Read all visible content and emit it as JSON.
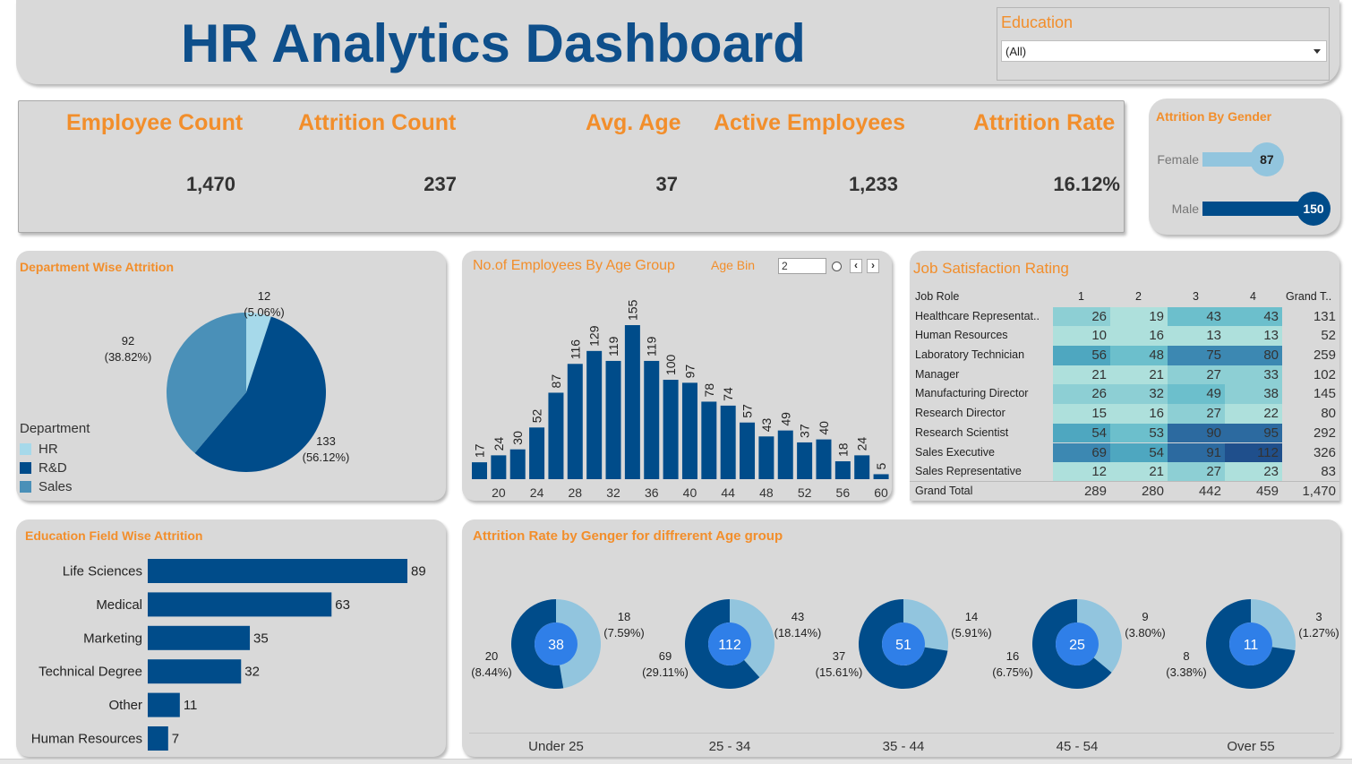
{
  "header": {
    "title": "HR Analytics Dashboard"
  },
  "filter": {
    "label": "Education",
    "value": "(All)"
  },
  "kpis": [
    {
      "title": "Employee Count",
      "value": "1,470"
    },
    {
      "title": "Attrition Count",
      "value": "237"
    },
    {
      "title": "Avg. Age",
      "value": "37"
    },
    {
      "title": "Active Employees",
      "value": "1,233"
    },
    {
      "title": "Attrition Rate",
      "value": "16.12%"
    }
  ],
  "gender": {
    "title": "Attrition By Gender",
    "rows": [
      {
        "label": "Female",
        "value": 87,
        "value_text": "87"
      },
      {
        "label": "Male",
        "value": 150,
        "value_text": "150"
      }
    ]
  },
  "department": {
    "title": "Department Wise Attrition",
    "legend_title": "Department",
    "legend": [
      "HR",
      "R&D",
      "Sales"
    ],
    "slice_labels": [
      {
        "count": "12",
        "pct": "(5.06%)"
      },
      {
        "count": "133",
        "pct": "(56.12%)"
      },
      {
        "count": "92",
        "pct": "(38.82%)"
      }
    ]
  },
  "age_group": {
    "title": "No.of Employees By Age Group",
    "param_label": "Age Bin",
    "param_value": "2"
  },
  "job_satisfaction": {
    "title": "Job Satisfaction Rating",
    "headers": [
      "Job Role",
      "1",
      "2",
      "3",
      "4",
      "Grand T.."
    ],
    "rows": [
      {
        "role": "Healthcare Representat..",
        "v": [
          "26",
          "19",
          "43",
          "43"
        ],
        "total": "131"
      },
      {
        "role": "Human Resources",
        "v": [
          "10",
          "16",
          "13",
          "13"
        ],
        "total": "52"
      },
      {
        "role": "Laboratory Technician",
        "v": [
          "56",
          "48",
          "75",
          "80"
        ],
        "total": "259"
      },
      {
        "role": "Manager",
        "v": [
          "21",
          "21",
          "27",
          "33"
        ],
        "total": "102"
      },
      {
        "role": "Manufacturing Director",
        "v": [
          "26",
          "32",
          "49",
          "38"
        ],
        "total": "145"
      },
      {
        "role": "Research Director",
        "v": [
          "15",
          "16",
          "27",
          "22"
        ],
        "total": "80"
      },
      {
        "role": "Research Scientist",
        "v": [
          "54",
          "53",
          "90",
          "95"
        ],
        "total": "292"
      },
      {
        "role": "Sales Executive",
        "v": [
          "69",
          "54",
          "91",
          "112"
        ],
        "total": "326"
      },
      {
        "role": "Sales Representative",
        "v": [
          "12",
          "21",
          "27",
          "23"
        ],
        "total": "83"
      }
    ],
    "grand_total": {
      "label": "Grand Total",
      "v": [
        "289",
        "280",
        "442",
        "459"
      ],
      "total": "1,470"
    }
  },
  "education_field": {
    "title": "Education Field Wise Attrition"
  },
  "age_gender": {
    "title": "Attrition Rate by Genger for diffrerent Age group",
    "groups": [
      {
        "label": "Under 25",
        "center": "38",
        "f_count": "18",
        "f_pct": "(7.59%)",
        "m_count": "20",
        "m_pct": "(8.44%)"
      },
      {
        "label": "25 - 34",
        "center": "112",
        "f_count": "43",
        "f_pct": "(18.14%)",
        "m_count": "69",
        "m_pct": "(29.11%)"
      },
      {
        "label": "35 - 44",
        "center": "51",
        "f_count": "14",
        "f_pct": "(5.91%)",
        "m_count": "37",
        "m_pct": "(15.61%)"
      },
      {
        "label": "45 - 54",
        "center": "25",
        "f_count": "9",
        "f_pct": "(3.80%)",
        "m_count": "16",
        "m_pct": "(6.75%)"
      },
      {
        "label": "Over 55",
        "center": "11",
        "f_count": "3",
        "f_pct": "(1.27%)",
        "m_count": "8",
        "m_pct": "(3.38%)"
      }
    ]
  },
  "colors": {
    "accent_orange": "#f28e2b",
    "navy": "#004c8a",
    "title_blue": "#0e4f8b",
    "light_blue": "#92c5de",
    "hr_blue": "#a6d9ea",
    "sales_blue": "#4a90b8",
    "center_blue": "#2f7fe8",
    "panel_gray": "#d9d9d9"
  },
  "chart_data": [
    {
      "type": "pie",
      "title": "Department Wise Attrition",
      "categories": [
        "HR",
        "R&D",
        "Sales"
      ],
      "values": [
        12,
        133,
        92
      ],
      "percent": [
        5.06,
        56.12,
        38.82
      ],
      "legend": "left"
    },
    {
      "type": "bar",
      "title": "No.of Employees By Age Group",
      "x": [
        18,
        19,
        20,
        21,
        22,
        23,
        24,
        25,
        26,
        27,
        28,
        29,
        30,
        31,
        32,
        33,
        34,
        35,
        36,
        37,
        38,
        39,
        40,
        41,
        42,
        43,
        44,
        45,
        46,
        47,
        48,
        49,
        50,
        51,
        52,
        53,
        54,
        55,
        56,
        57,
        58,
        59,
        60
      ],
      "x_bins": [
        18,
        20,
        22,
        24,
        26,
        28,
        30,
        32,
        34,
        36,
        38,
        40,
        42,
        44,
        46,
        48,
        50,
        52,
        54,
        56,
        58,
        60
      ],
      "values": [
        17,
        24,
        30,
        52,
        87,
        116,
        129,
        119,
        155,
        119,
        100,
        97,
        78,
        74,
        57,
        43,
        49,
        37,
        40,
        18,
        24,
        5
      ],
      "xticks": [
        20,
        24,
        28,
        32,
        36,
        40,
        44,
        48,
        52,
        56,
        60
      ]
    },
    {
      "type": "heatmap",
      "title": "Job Satisfaction Rating",
      "rows": [
        "Healthcare Representative",
        "Human Resources",
        "Laboratory Technician",
        "Manager",
        "Manufacturing Director",
        "Research Director",
        "Research Scientist",
        "Sales Executive",
        "Sales Representative"
      ],
      "columns": [
        "1",
        "2",
        "3",
        "4"
      ],
      "values": [
        [
          26,
          19,
          43,
          43
        ],
        [
          10,
          16,
          13,
          13
        ],
        [
          56,
          48,
          75,
          80
        ],
        [
          21,
          21,
          27,
          33
        ],
        [
          26,
          32,
          49,
          38
        ],
        [
          15,
          16,
          27,
          22
        ],
        [
          54,
          53,
          90,
          95
        ],
        [
          69,
          54,
          91,
          112
        ],
        [
          12,
          21,
          27,
          23
        ]
      ]
    },
    {
      "type": "bar",
      "orientation": "horizontal",
      "title": "Education Field Wise Attrition",
      "categories": [
        "Life Sciences",
        "Medical",
        "Marketing",
        "Technical Degree",
        "Other",
        "Human Resources"
      ],
      "values": [
        89,
        63,
        35,
        32,
        11,
        7
      ]
    },
    {
      "type": "pie",
      "title": "Attrition Rate by Genger for diffrerent Age group",
      "categories": [
        "Under 25",
        "25 - 34",
        "35 - 44",
        "45 - 54",
        "Over 55"
      ],
      "series": [
        {
          "values": [
            18,
            43,
            14,
            9,
            3
          ]
        },
        {
          "values": [
            20,
            69,
            37,
            16,
            8
          ]
        }
      ]
    },
    {
      "type": "bar",
      "orientation": "horizontal",
      "title": "Attrition By Gender",
      "categories": [
        "Female",
        "Male"
      ],
      "values": [
        87,
        150
      ]
    }
  ]
}
